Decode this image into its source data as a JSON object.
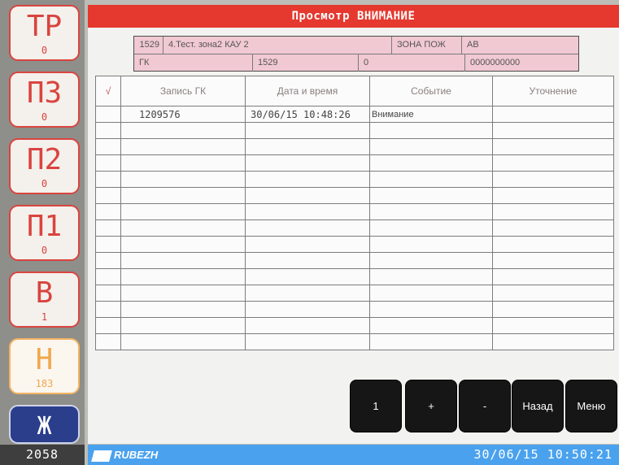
{
  "sidebar": {
    "buttons": [
      {
        "code": "ТР",
        "count": "0"
      },
      {
        "code": "ПЗ",
        "count": "0"
      },
      {
        "code": "П2",
        "count": "0"
      },
      {
        "code": "П1",
        "count": "0"
      },
      {
        "code": "В",
        "count": "1"
      },
      {
        "code": "Н",
        "count": "183"
      },
      {
        "code": "Ж",
        "count": "2058"
      }
    ]
  },
  "title": "Просмотр ВНИМАНИЕ",
  "info": {
    "row1": {
      "num": "1529",
      "name": "4.Тест. зона2 КАУ 2",
      "zone_label": "ЗОНА ПОЖ",
      "ab": "АВ"
    },
    "row2": {
      "gk": "ГК",
      "num": "1529",
      "zero": "0",
      "code": "0000000000"
    }
  },
  "table": {
    "headers": {
      "check": "√",
      "record": "Запись ГК",
      "datetime": "Дата и время",
      "event": "Событие",
      "detail": "Уточнение"
    },
    "rows": [
      {
        "record": "1209576",
        "datetime": "30/06/15 10:48:26",
        "event": "Внимание",
        "detail": ""
      }
    ]
  },
  "buttons": {
    "one": "1",
    "plus": "+",
    "minus": "-",
    "back": "Назад",
    "menu": "Меню"
  },
  "footer": {
    "logo": "RUBEZH",
    "datetime": "30/06/15 10:50:21"
  },
  "colors": {
    "accent_red": "#e5382e",
    "footer_blue": "#4aa2ee",
    "info_pink": "#f1c9d2",
    "badge_orange": "#f0a74c",
    "badge_dark": "#2a3e8c"
  }
}
